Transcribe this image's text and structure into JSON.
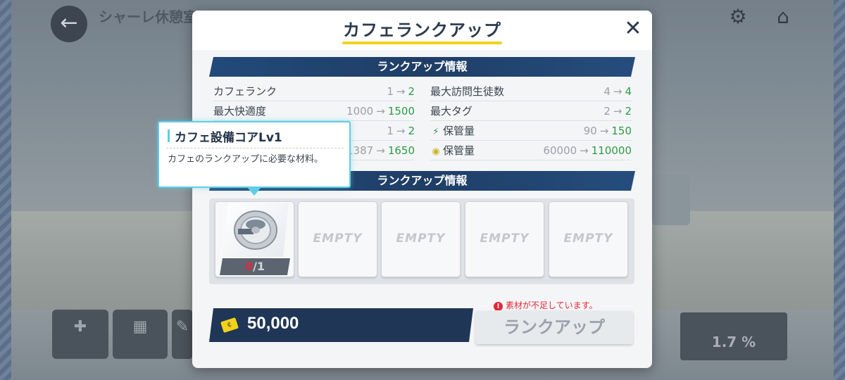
{
  "background": {
    "header_title": "シャーレ休憩室",
    "toolbar": [
      "",
      "",
      ""
    ],
    "bottom_label": "",
    "stat_value": "1.7 %"
  },
  "modal": {
    "title": "カフェランクアップ",
    "section1_title": "ランクアップ情報",
    "section2_title": "ランクアップ情報",
    "stats_left": [
      {
        "label": "カフェランク",
        "old": "1",
        "new": "2"
      },
      {
        "label": "最大快適度",
        "old": "1000",
        "new": "1500"
      },
      {
        "label": "",
        "old": "1",
        "new": "2"
      },
      {
        "label": "",
        "old": "1387",
        "new": "1650"
      }
    ],
    "stats_right": [
      {
        "label": "最大訪問生徒数",
        "old": "4",
        "new": "4",
        "icon": ""
      },
      {
        "label": "最大タグ",
        "old": "2",
        "new": "2",
        "icon": ""
      },
      {
        "label": "保管量",
        "old": "90",
        "new": "150",
        "icon": "ap-lightning-icon"
      },
      {
        "label": "保管量",
        "old": "60000",
        "new": "110000",
        "icon": "credit-coin-icon"
      }
    ],
    "materials": {
      "item_name": "カフェ設備コアLv1",
      "owned": "0",
      "required": "1",
      "empty_slots": [
        "EMPTY",
        "EMPTY",
        "EMPTY",
        "EMPTY"
      ]
    },
    "cost": "50,000",
    "warning": "素材が不足しています。",
    "button_label": "ランクアップ"
  },
  "tooltip": {
    "title": "カフェ設備コアLv1",
    "body": "カフェのランクアップに必要な材料。"
  },
  "colors": {
    "accent_blue": "#214a7a",
    "value_green": "#2c9a48",
    "warn_red": "#e0293a",
    "tooltip_cyan": "#5fcde6",
    "title_underline": "#f2d21b"
  }
}
